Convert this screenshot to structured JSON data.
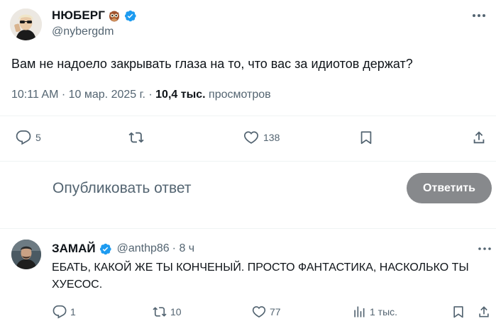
{
  "tweet": {
    "author_name": "НЮБЕРГ",
    "author_handle": "@nybergdm",
    "text": "Вам не надоело закрывать глаза на то, что вас за идиотов держат?",
    "timestamp": "10:11 AM · 10 мар. 2025 г.",
    "separator": " · ",
    "views_count": "10,4 тыс.",
    "views_label": " просмотров",
    "replies": "5",
    "retweets": "",
    "likes": "138"
  },
  "composer": {
    "placeholder": "Опубликовать ответ",
    "button_label": "Ответить"
  },
  "reply": {
    "author_name": "ЗАМАЙ",
    "author_handle": "@anthp86",
    "time": "· 8 ч",
    "text": "ЕБАТЬ, КАКОЙ ЖЕ ТЫ КОНЧЕНЫЙ. ПРОСТО ФАНТАСТИКА, НАСКОЛЬКО ТЫ ХУЕСОС.",
    "replies": "1",
    "retweets": "10",
    "likes": "77",
    "views": "1 тыс."
  },
  "icons": {
    "verified": "verified-badge-icon",
    "owl": "owl-emoji-icon",
    "more": "more-icon",
    "reply": "reply-icon",
    "retweet": "retweet-icon",
    "like": "heart-icon",
    "bookmark": "bookmark-icon",
    "share": "share-icon",
    "views": "views-icon"
  },
  "colors": {
    "accent": "#1d9bf0",
    "text": "#0f1419",
    "secondary": "#536471",
    "button_disabled": "#87898c"
  }
}
